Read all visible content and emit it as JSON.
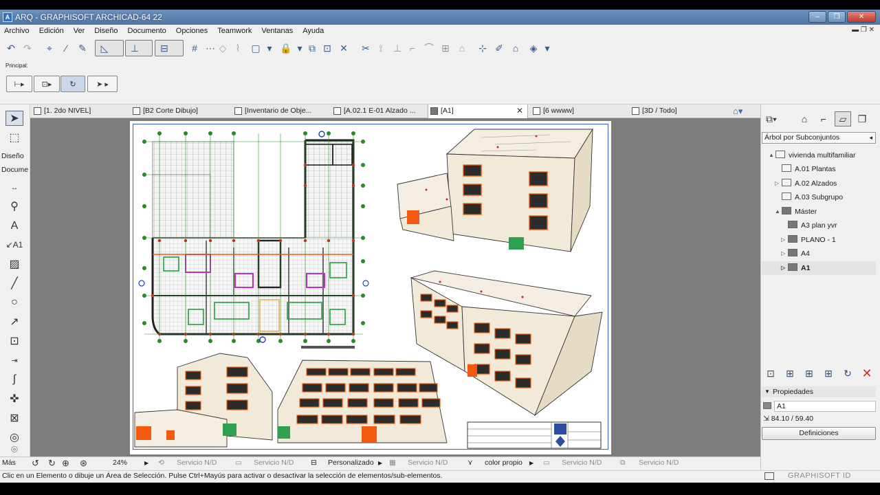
{
  "window": {
    "title": "ARQ - GRAPHISOFT ARCHICAD-64 22"
  },
  "menu": [
    "Archivo",
    "Edición",
    "Ver",
    "Diseño",
    "Documento",
    "Opciones",
    "Teamwork",
    "Ventanas",
    "Ayuda"
  ],
  "toolbox": {
    "panel_label": "Principal:",
    "section_design": "Diseño",
    "section_doc": "Docume",
    "more": "Más"
  },
  "tabs": [
    {
      "label": "[1. 2do    NIVEL]",
      "active": false
    },
    {
      "label": "[B2 Corte Dibujo]",
      "active": false
    },
    {
      "label": "[Inventario de Obje...",
      "active": false
    },
    {
      "label": "[A.02.1 E-01 Alzado ...",
      "active": false
    },
    {
      "label": "[A1]",
      "active": true
    },
    {
      "label": "[6 wwww]",
      "active": false
    },
    {
      "label": "[3D / Todo]",
      "active": false
    }
  ],
  "navigator": {
    "view_mode": "Árbol por Subconjuntos",
    "tree": [
      {
        "label": "vivienda multifamiliar",
        "level": 0,
        "expand": "▲"
      },
      {
        "label": "A.01 Plantas",
        "level": 1,
        "expand": ""
      },
      {
        "label": "A.02 Alzados",
        "level": 1,
        "expand": "▷"
      },
      {
        "label": "A.03 Subgrupo",
        "level": 1,
        "expand": ""
      },
      {
        "label": "Máster",
        "level": 1,
        "expand": "▲"
      },
      {
        "label": "A3 plan yvr",
        "level": 2,
        "expand": ""
      },
      {
        "label": "PLANO - 1",
        "level": 2,
        "expand": "▷"
      },
      {
        "label": "A4",
        "level": 2,
        "expand": "▷"
      },
      {
        "label": "A1",
        "level": 2,
        "expand": "▷",
        "selected": true
      }
    ]
  },
  "properties": {
    "header": "Propiedades",
    "name": "A1",
    "size": "84.10 / 59.40",
    "settings_button": "Definiciones"
  },
  "navbar": {
    "zoom": "24%",
    "items": [
      "Servicio N/D",
      "Servicio N/D",
      "Personalizado",
      "Servicio N/D",
      "color propio",
      "Servicio N/D",
      "Servicio N/D"
    ]
  },
  "status": {
    "message": "Clic en un Elemento o dibuje un Área de Selección. Pulse Ctrl+Mayús para activar o desactivar la selección de elementos/sub-elementos.",
    "brand": "GRAPHISOFT ID"
  },
  "colors": {
    "accent": "#3a5cc8",
    "wall": "#2b2b2b",
    "orange": "#f25a10",
    "facade": "#f2ead9"
  }
}
